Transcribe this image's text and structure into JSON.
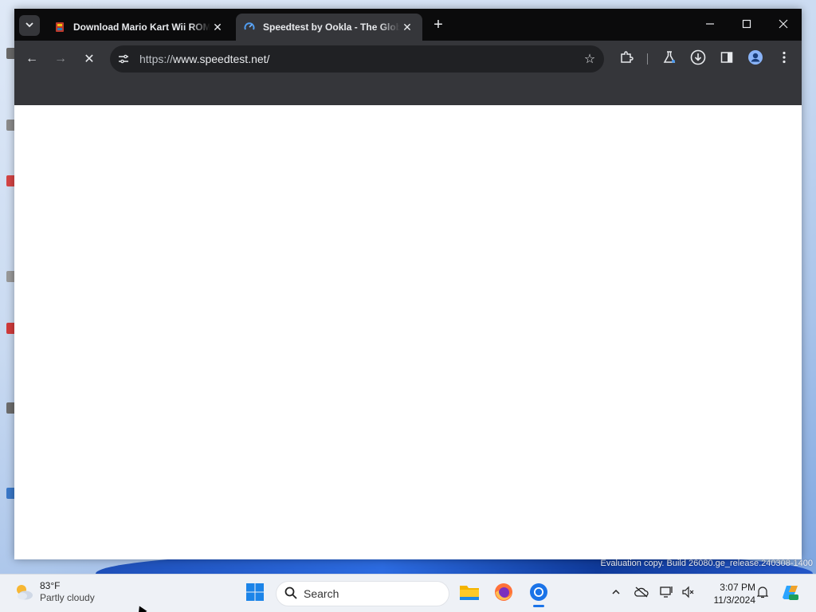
{
  "browser": {
    "tabs": [
      {
        "title": "Download Mario Kart Wii ROM",
        "close": "✕",
        "favicon": "rom-site-icon",
        "active": false
      },
      {
        "title": "Speedtest by Ookla - The Global Broadband Speed Test",
        "close": "✕",
        "favicon": "speedtest-icon",
        "active": true
      }
    ],
    "new_tab": "+",
    "window_controls": {
      "minimize": "—",
      "maximize": "☐",
      "close": "✕"
    },
    "toolbar": {
      "back": "←",
      "forward": "→",
      "stop": "✕",
      "url_scheme": "https://",
      "url_host": "www.speedtest.net/",
      "star": "☆"
    }
  },
  "desktop": {
    "watermark": "Evaluation copy. Build 26080.ge_release.240308-1400"
  },
  "taskbar": {
    "weather": {
      "temp": "83°F",
      "condition": "Partly cloudy"
    },
    "search_placeholder": "Search",
    "clock": {
      "time": "3:07 PM",
      "date": "11/3/2024"
    }
  },
  "colors": {
    "tabstrip": "#0b0b0c",
    "toolbar": "#35363a",
    "omnibox": "#202124",
    "taskbar": "#eef1f6"
  }
}
